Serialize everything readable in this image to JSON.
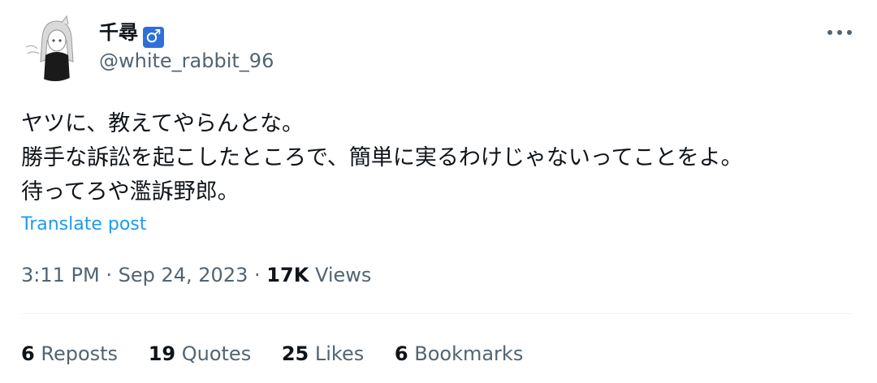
{
  "author": {
    "display_name": "千尋",
    "badge_symbol": "♂",
    "handle": "@white_rabbit_96"
  },
  "post": {
    "lines": [
      "ヤツに、教えてやらんとな。",
      "勝手な訴訟を起こしたところで、簡単に実るわけじゃないってことをよ。",
      "待ってろや濫訴野郎。"
    ],
    "translate_label": "Translate post"
  },
  "meta": {
    "time": "3:11 PM",
    "date": "Sep 24, 2023",
    "separator": "·",
    "views_count": "17K",
    "views_label": "Views"
  },
  "stats": {
    "reposts_count": "6",
    "reposts_label": "Reposts",
    "quotes_count": "19",
    "quotes_label": "Quotes",
    "likes_count": "25",
    "likes_label": "Likes",
    "bookmarks_count": "6",
    "bookmarks_label": "Bookmarks"
  },
  "icons": {
    "more": "more-horizontal-icon",
    "badge": "male-symbol-icon"
  },
  "colors": {
    "text_primary": "#0f1419",
    "text_secondary": "#536471",
    "link": "#1d9bf0",
    "badge_bg": "#2e6fd8",
    "divider": "#eff3f4"
  }
}
